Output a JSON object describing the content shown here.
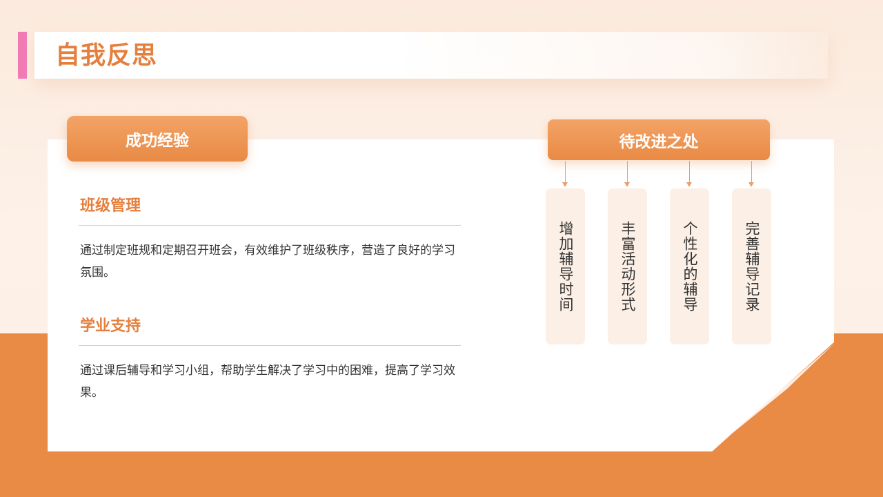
{
  "title": "自我反思",
  "left": {
    "header": "成功经验",
    "sections": [
      {
        "heading": "班级管理",
        "text": "通过制定班规和定期召开班会，有效维护了班级秩序，营造了良好的学习氛围。"
      },
      {
        "heading": "学业支持",
        "text": "通过课后辅导和学习小组，帮助学生解决了学习中的困难，提高了学习效果。"
      }
    ]
  },
  "right": {
    "header": "待改进之处",
    "items": [
      "增加辅导时间",
      "丰富活动形式",
      "个性化的辅导",
      "完善辅导记录"
    ]
  },
  "colors": {
    "accent": "#e98a45",
    "title": "#e57f3d",
    "pink_marker": "#f07bb5",
    "item_bg": "#fcefe5"
  }
}
